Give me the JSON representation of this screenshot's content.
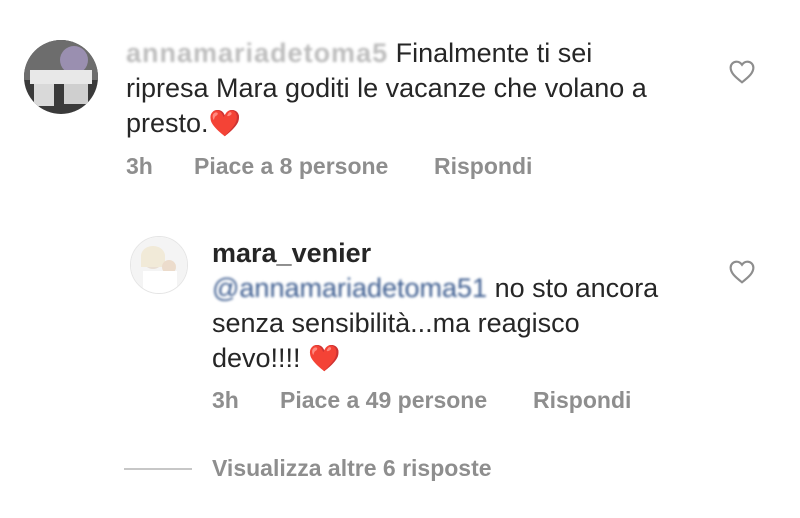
{
  "comment1": {
    "username": "annamariadetoma5",
    "text_line1": "Finalmente ti sei",
    "text_line2": "ripresa Mara goditi le vacanze che volano a",
    "text_line3": "presto.",
    "heart": "❤️",
    "time": "3h",
    "likes": "Piace a 8 persone",
    "reply": "Rispondi",
    "like_icon": "heart-outline-icon"
  },
  "reply1": {
    "username": "mara_venier",
    "mention": "@annamariadetoma51",
    "text_line1": "no sto ancora",
    "text_line2": "senza sensibilità...ma reagisco",
    "text_line3": "devo!!!!",
    "heart": "❤️",
    "time": "3h",
    "likes": "Piace a 49 persone",
    "reply": "Rispondi",
    "like_icon": "heart-outline-icon"
  },
  "more_replies": {
    "label": "Visualizza altre 6 risposte"
  },
  "colors": {
    "text": "#262626",
    "secondary": "#8e8e8e",
    "heart": "#e0192f",
    "mention": "#3c5c8f"
  }
}
